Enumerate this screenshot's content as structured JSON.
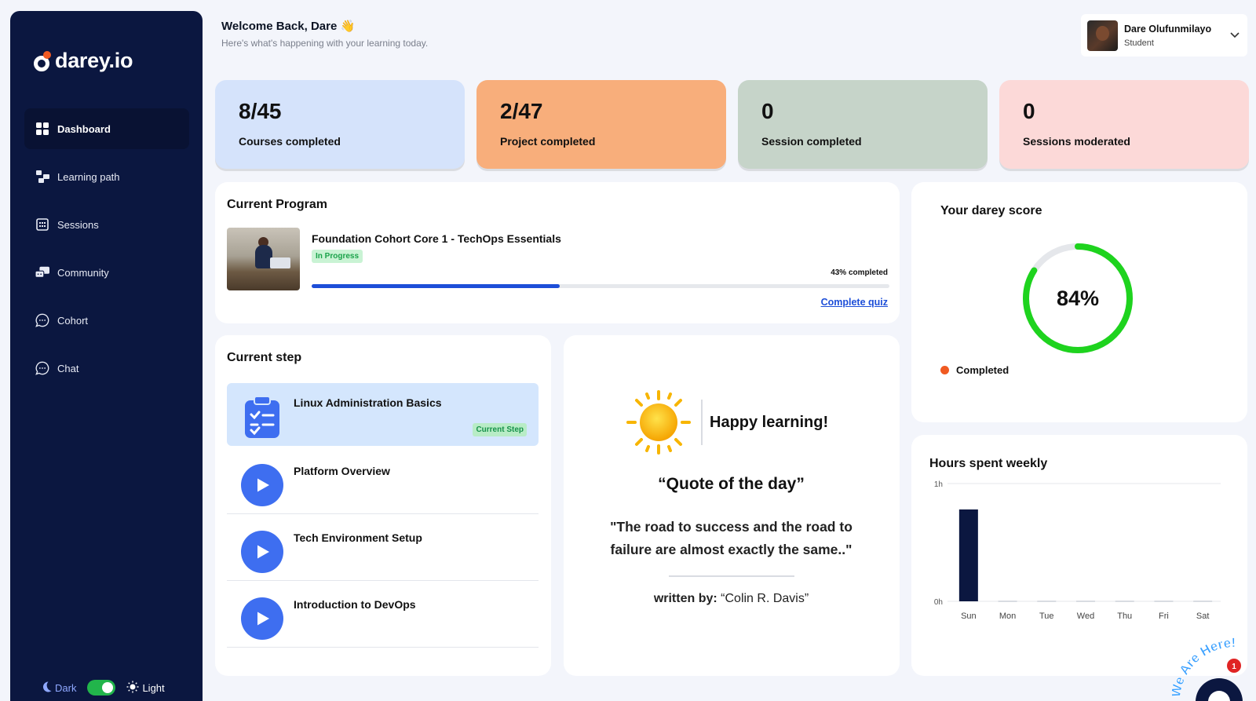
{
  "sidebar": {
    "logo_text": "darey.io",
    "items": [
      {
        "label": "Dashboard",
        "icon": "grid-icon",
        "active": true
      },
      {
        "label": "Learning path",
        "icon": "path-icon"
      },
      {
        "label": "Sessions",
        "icon": "calendar-icon"
      },
      {
        "label": "Community",
        "icon": "community-icon"
      },
      {
        "label": "Cohort",
        "icon": "chat-bubble-icon"
      },
      {
        "label": "Chat",
        "icon": "chat-bubble-icon"
      }
    ],
    "theme": {
      "dark_label": "Dark",
      "light_label": "Light",
      "mode": "light"
    }
  },
  "header": {
    "welcome": "Welcome Back, Dare 👋",
    "subtitle": "Here's what's happening with your learning today."
  },
  "user": {
    "name": "Dare Olufunmilayo",
    "role": "Student"
  },
  "stats": [
    {
      "value": "8/45",
      "label": "Courses completed",
      "color": "#d5e3fb"
    },
    {
      "value": "2/47",
      "label": "Project completed",
      "color": "#f8ae7b"
    },
    {
      "value": "0",
      "label": "Session completed",
      "color": "#c6d4c9"
    },
    {
      "value": "0",
      "label": "Sessions moderated",
      "color": "#fcd9d8"
    }
  ],
  "program": {
    "heading": "Current Program",
    "name": "Foundation Cohort Core 1 - TechOps Essentials",
    "status": "In Progress",
    "progress_label": "43% completed",
    "progress": 0.43,
    "action": "Complete quiz"
  },
  "current_step": {
    "heading": "Current step",
    "steps": [
      {
        "title": "Linux Administration Basics",
        "badge": "Current Step",
        "current": true
      },
      {
        "title": "Platform Overview"
      },
      {
        "title": "Tech Environment Setup"
      },
      {
        "title": "Introduction to DevOps"
      }
    ]
  },
  "quote": {
    "greeting": "Happy learning!",
    "heading": "“Quote of the day”",
    "text": "\"The road to success and the road to failure are almost exactly the same..\"",
    "author_prefix": "written by:",
    "author": "“Colin R. Davis”"
  },
  "score": {
    "title": "Your darey score",
    "value_label": "84%",
    "value": 0.84,
    "legend": "Completed",
    "colors": {
      "ring": "#1ed31e",
      "track": "#e5e7eb",
      "legend_dot": "#f05a22"
    }
  },
  "chart_data": {
    "type": "bar",
    "title": "Hours spent weekly",
    "categories": [
      "Sun",
      "Mon",
      "Tue",
      "Wed",
      "Thu",
      "Fri",
      "Sat"
    ],
    "values": [
      0.78,
      0,
      0,
      0,
      0,
      0,
      0
    ],
    "yticks": [
      "0h",
      "1h"
    ],
    "ylim": [
      0,
      1
    ],
    "bar_color": "#0b1740",
    "grid": true
  },
  "chat_widget": {
    "text": "We Are Here!",
    "unread": "1"
  }
}
